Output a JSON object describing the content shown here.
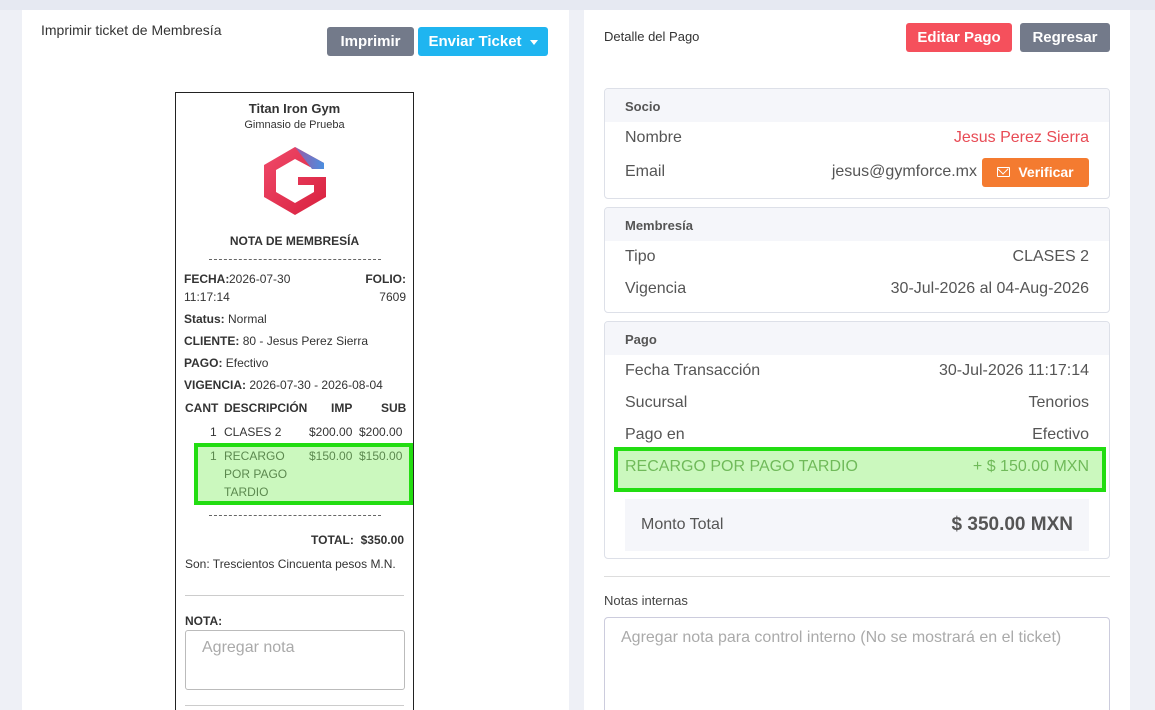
{
  "left": {
    "title": "Imprimir ticket de Membresía",
    "print_label": "Imprimir",
    "send_label": "Enviar Ticket"
  },
  "ticket": {
    "gym_name": "Titan Iron Gym",
    "gym_sub": "Gimnasio de Prueba",
    "heading": "NOTA DE MEMBRESÍA",
    "fecha_label": "FECHA:",
    "fecha_value": "2026-07-30",
    "time_value": "11:17:14",
    "folio_label": "FOLIO:",
    "folio_value": "7609",
    "status_label": "Status:",
    "status_value": "Normal",
    "cliente_label": "CLIENTE:",
    "cliente_value": "80 - Jesus Perez Sierra",
    "pago_label": "PAGO:",
    "pago_value": "Efectivo",
    "vigencia_label": "VIGENCIA:",
    "vigencia_value": "2026-07-30 - 2026-08-04",
    "columns": [
      "CANT",
      "DESCRIPCIÓN",
      "IMP",
      "SUB"
    ],
    "items": [
      {
        "cant": "1",
        "desc": [
          "CLASES 2"
        ],
        "imp": "$200.00",
        "sub": "$200.00"
      },
      {
        "cant": "1",
        "desc": [
          "RECARGO",
          "POR PAGO",
          "TARDIO"
        ],
        "imp": "$150.00",
        "sub": "$150.00"
      }
    ],
    "total_label": "TOTAL:",
    "total_value": "$350.00",
    "son_text": "Son: Trescientos Cincuenta pesos M.N.",
    "nota_label": "NOTA:",
    "nota_placeholder": "Agregar nota"
  },
  "right": {
    "title": "Detalle del Pago",
    "edit_label": "Editar Pago",
    "back_label": "Regresar",
    "socio": {
      "head": "Socio",
      "nombre_label": "Nombre",
      "nombre_value": "Jesus Perez Sierra",
      "email_label": "Email",
      "email_value": "jesus@gymforce.mx",
      "verify_label": "Verificar"
    },
    "membresia": {
      "head": "Membresía",
      "tipo_label": "Tipo",
      "tipo_value": "CLASES 2",
      "vigencia_label": "Vigencia",
      "vigencia_value": "30-Jul-2026 al 04-Aug-2026"
    },
    "pago": {
      "head": "Pago",
      "fecha_label": "Fecha Transacción",
      "fecha_value": "30-Jul-2026 11:17:14",
      "sucursal_label": "Sucursal",
      "sucursal_value": "Tenorios",
      "pagoen_label": "Pago en",
      "pagoen_value": "Efectivo",
      "recargo_label": "RECARGO POR PAGO TARDIO",
      "recargo_value": "+ $ 150.00 MXN",
      "total_label": "Monto Total",
      "total_value": "$ 350.00 MXN"
    },
    "notes_title": "Notas internas",
    "notes_placeholder": "Agregar nota para control interno (No se mostrará en el ticket)"
  },
  "colors": {
    "accent_blue": "#1fb5f0",
    "danger_red": "#f5505c",
    "warning_orange": "#f47b30",
    "neutral_gray": "#737a8a",
    "highlight_green": "#22dd11"
  }
}
